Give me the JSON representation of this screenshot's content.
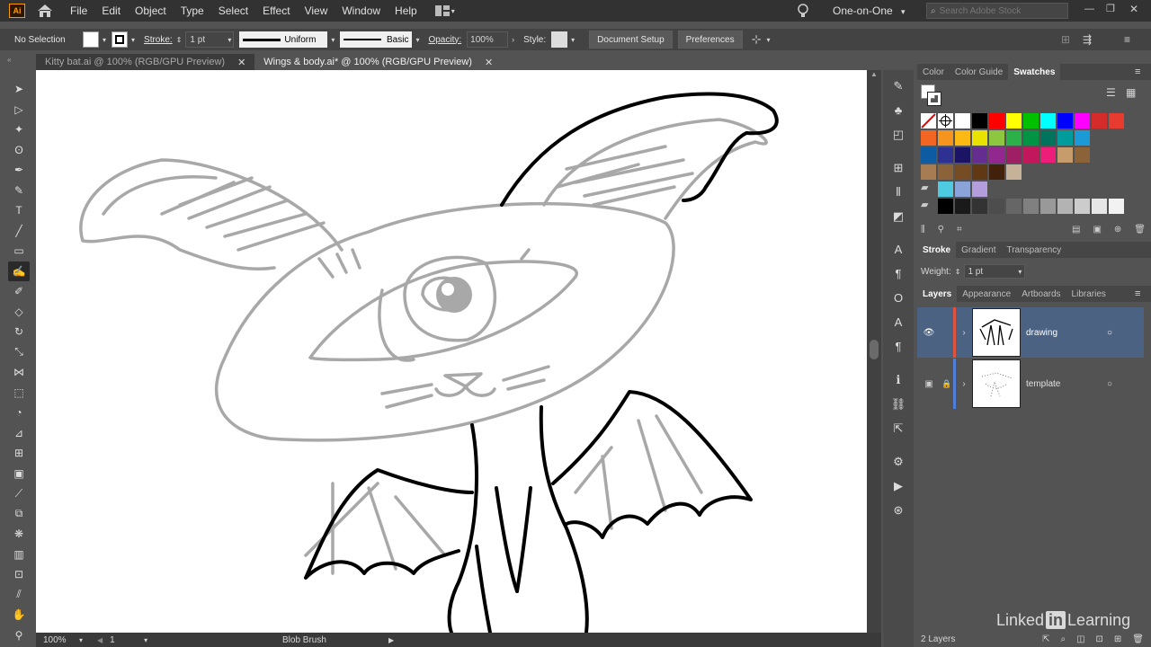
{
  "menubar": {
    "app_logo": "Ai",
    "items": [
      "File",
      "Edit",
      "Object",
      "Type",
      "Select",
      "Effect",
      "View",
      "Window",
      "Help"
    ],
    "workspace": "One-on-One",
    "search_placeholder": "Search Adobe Stock"
  },
  "controlbar": {
    "selection": "No Selection",
    "stroke_label": "Stroke:",
    "stroke_value": "1 pt",
    "profile_uniform": "Uniform",
    "brush_basic": "Basic",
    "opacity_label": "Opacity:",
    "opacity_value": "100%",
    "style_label": "Style:",
    "document_setup": "Document Setup",
    "preferences": "Preferences"
  },
  "tabs": [
    {
      "label": "Kitty bat.ai @ 100% (RGB/GPU Preview)",
      "active": false
    },
    {
      "label": "Wings & body.ai* @ 100% (RGB/GPU Preview)",
      "active": true
    }
  ],
  "tools": [
    "selection-icon",
    "direct-selection-icon",
    "magic-wand-icon",
    "lasso-icon",
    "pen-icon",
    "curvature-icon",
    "type-icon",
    "line-icon",
    "rectangle-icon",
    "blob-brush-icon",
    "shaper-icon",
    "eraser-icon",
    "rotate-icon",
    "scale-icon",
    "width-icon",
    "free-transform-icon",
    "shape-builder-icon",
    "perspective-icon",
    "mesh-icon",
    "gradient-icon",
    "eyedropper-icon",
    "blend-icon",
    "symbol-sprayer-icon",
    "column-graph-icon",
    "artboard-icon",
    "slice-icon",
    "hand-icon",
    "zoom-icon"
  ],
  "statusbar": {
    "zoom": "100%",
    "artboard": "1",
    "current_tool": "Blob Brush"
  },
  "panels": {
    "color_tabs": [
      "Color",
      "Color Guide",
      "Swatches"
    ],
    "active_color_tab": "Swatches",
    "stroke_tabs": [
      "Stroke",
      "Gradient",
      "Transparency"
    ],
    "weight_label": "Weight:",
    "weight_value": "1 pt",
    "layers_tabs": [
      "Layers",
      "Appearance",
      "Artboards",
      "Libraries"
    ],
    "layers": [
      {
        "name": "drawing",
        "color": "#e0533d",
        "visible": true,
        "locked": false,
        "selected": true
      },
      {
        "name": "template",
        "color": "#4f7fd8",
        "visible": true,
        "locked": true,
        "selected": false
      }
    ],
    "layer_count": "2 Layers"
  },
  "swatch_colors": [
    [
      "#ffffff",
      "#000000",
      "#ff0000",
      "#ffff00",
      "#00c000",
      "#00ffff",
      "#0000ff",
      "#ff00ff",
      "#d52b2b",
      "#e63b2e"
    ],
    [
      "#f26522",
      "#f7941d",
      "#fdb913",
      "#e9e200",
      "#8dc63f",
      "#2bb04a",
      "#009444",
      "#00735d",
      "#009c9c",
      "#1c9ad6"
    ],
    [
      "#0d5ba3",
      "#2e3192",
      "#1b1464",
      "#662d91",
      "#92278f",
      "#9e1f63",
      "#c2185b",
      "#ed1e79",
      "#c69c6d",
      "#8c6239"
    ],
    [
      "#a67c52",
      "#8c6239",
      "#754c24",
      "#603813",
      "#42210b",
      "#c7b299"
    ],
    [
      "#4ecbe0",
      "#8aa3d8",
      "#b39ddb"
    ],
    [
      "#000000",
      "#1a1a1a",
      "#333333",
      "#4d4d4d",
      "#666666",
      "#808080",
      "#999999",
      "#b3b3b3",
      "#cccccc",
      "#e6e6e6",
      "#f2f2f2"
    ]
  ],
  "watermark": {
    "linked": "Linked",
    "in": "in",
    "learning": "Learning"
  }
}
